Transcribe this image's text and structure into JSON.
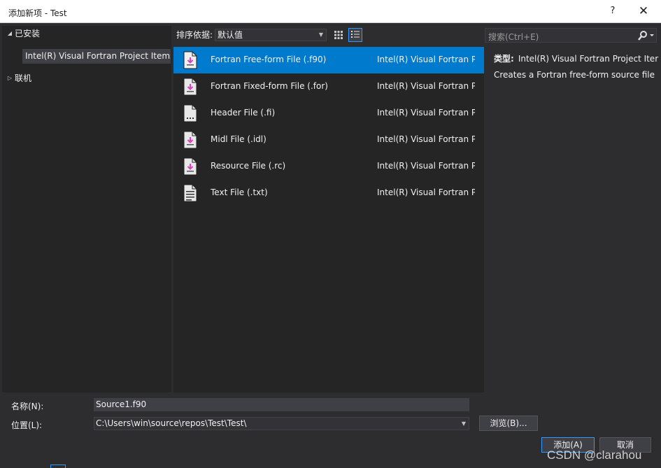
{
  "window": {
    "title": "添加新项 - Test",
    "help": "?",
    "close": "✕"
  },
  "tree": {
    "installed": "已安装",
    "selected_item": "Intel(R) Visual Fortran Project Items",
    "online": "联机"
  },
  "sort": {
    "label": "排序依据:",
    "value": "默认值"
  },
  "items": [
    {
      "name": "Fortran Free-form File (.f90)",
      "category": "Intel(R) Visual Fortran Pr",
      "icon": "fortran-file-icon"
    },
    {
      "name": "Fortran Fixed-form File (.for)",
      "category": "Intel(R) Visual Fortran Pr",
      "icon": "fortran-file-icon"
    },
    {
      "name": "Header File (.fi)",
      "category": "Intel(R) Visual Fortran Pr",
      "icon": "header-file-icon"
    },
    {
      "name": "Midl File (.idl)",
      "category": "Intel(R) Visual Fortran Pr",
      "icon": "fortran-file-icon"
    },
    {
      "name": "Resource File (.rc)",
      "category": "Intel(R) Visual Fortran Pr",
      "icon": "fortran-file-icon"
    },
    {
      "name": "Text File (.txt)",
      "category": "Intel(R) Visual Fortran Pr",
      "icon": "text-file-icon"
    }
  ],
  "search": {
    "placeholder": "搜索(Ctrl+E)"
  },
  "details": {
    "type_label": "类型:",
    "type_value": "Intel(R) Visual Fortran Project Iter",
    "description": "Creates a Fortran free-form source file"
  },
  "form": {
    "name_label": "名称(N):",
    "name_value": "Source1.f90",
    "location_label": "位置(L):",
    "location_value": "C:\\Users\\win\\source\\repos\\Test\\Test\\",
    "browse": "浏览(B)...",
    "add": "添加(A)",
    "cancel": "取消"
  },
  "watermark": "CSDN @clarahou",
  "colors": {
    "selection": "#007acc",
    "accent": "#3399ff",
    "file_icon_accent": "#e040c0"
  }
}
